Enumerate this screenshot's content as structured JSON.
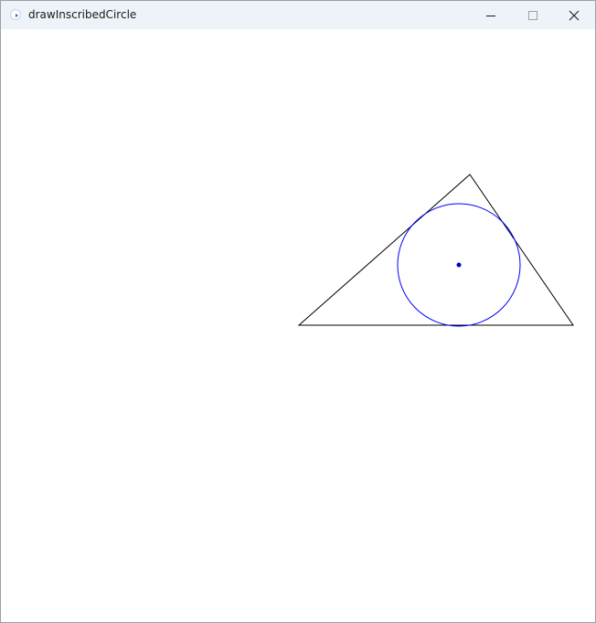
{
  "window": {
    "title": "drawInscribedCircle",
    "icons": {
      "app": "app-icon",
      "minimize": "minimize-icon",
      "maximize": "maximize-icon",
      "close": "close-icon"
    }
  },
  "drawing": {
    "triangle_color": "#000000",
    "circle_color": "#0000ff",
    "center_color": "#0000cc"
  }
}
